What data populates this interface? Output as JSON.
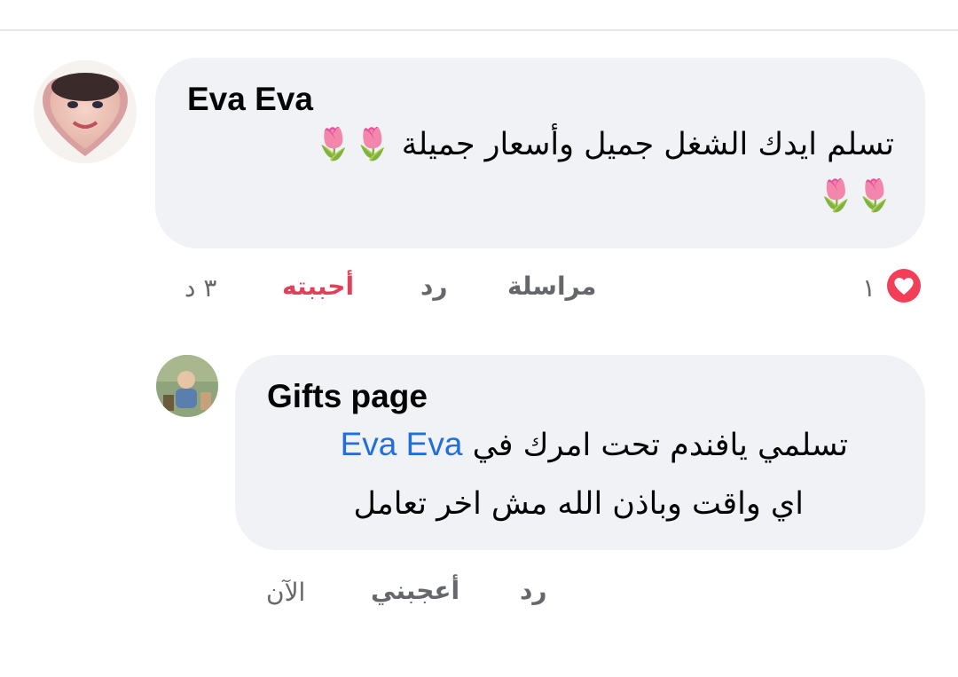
{
  "comments": [
    {
      "author": "Eva Eva",
      "text_line1": "تسلم ايدك الشغل جميل وأسعار جميلة",
      "emoji_line1": "🌷🌷",
      "emoji_line2": "🌷🌷",
      "actions": {
        "message": "مراسلة",
        "reply": "رد",
        "like": "أحببته",
        "time": "٣ د"
      },
      "reaction": {
        "type": "love",
        "count": "١"
      },
      "colors": {
        "liked": "#e0405a",
        "reaction": "#f33e58"
      }
    },
    {
      "author": "Gifts page",
      "text_line1_pre": "تسلمي يافندم تحت امرك في",
      "mention": "Eva Eva",
      "text_line2": "اي واقت وباذن الله مش اخر تعامل",
      "actions": {
        "reply": "رد",
        "like": "أعجبني",
        "time": "الآن"
      },
      "colors": {
        "mention": "#216fdb"
      }
    }
  ],
  "icons": [
    "avatar",
    "love-reaction-icon",
    "tulip-emoji"
  ]
}
